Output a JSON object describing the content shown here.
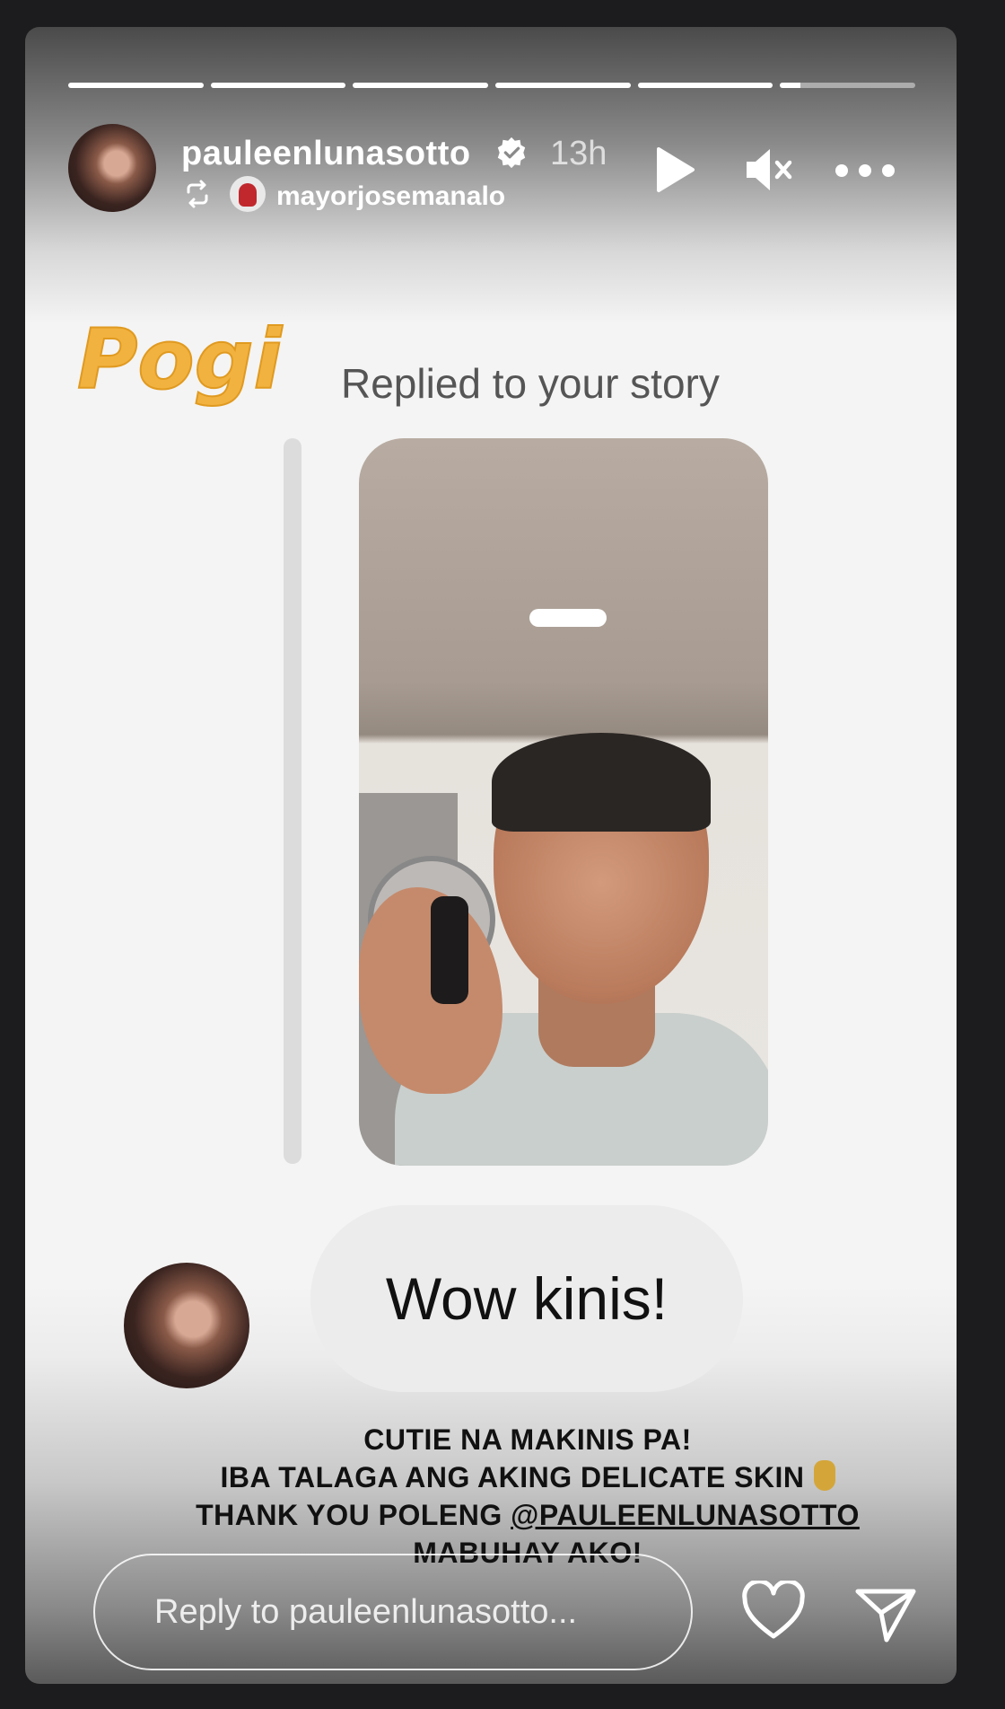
{
  "story": {
    "progress_segments": [
      1,
      1,
      1,
      1,
      1,
      0.15
    ],
    "username": "pauleenlunasotto",
    "verified": true,
    "time_ago": "13h",
    "reposted_from": "mayorjosemanalo"
  },
  "sticker": {
    "text": "Pogi",
    "color": "#f2b23f"
  },
  "reply_card": {
    "label": "Replied to your story",
    "message": "Wow kinis!"
  },
  "caption": {
    "line1": "CUTIE NA MAKINIS PA!",
    "line2": "IBA TALAGA ANG AKING DELICATE SKIN",
    "line3_prefix": "THANK YOU POLENG ",
    "line3_mention": "@PAULEENLUNASOTTO",
    "line4": "MABUHAY AKO!"
  },
  "footer": {
    "reply_placeholder": "Reply to pauleenlunasotto..."
  },
  "icons": {
    "header": [
      "play-icon",
      "mute-icon",
      "more-icon"
    ],
    "footer": [
      "heart-icon",
      "send-icon"
    ]
  }
}
